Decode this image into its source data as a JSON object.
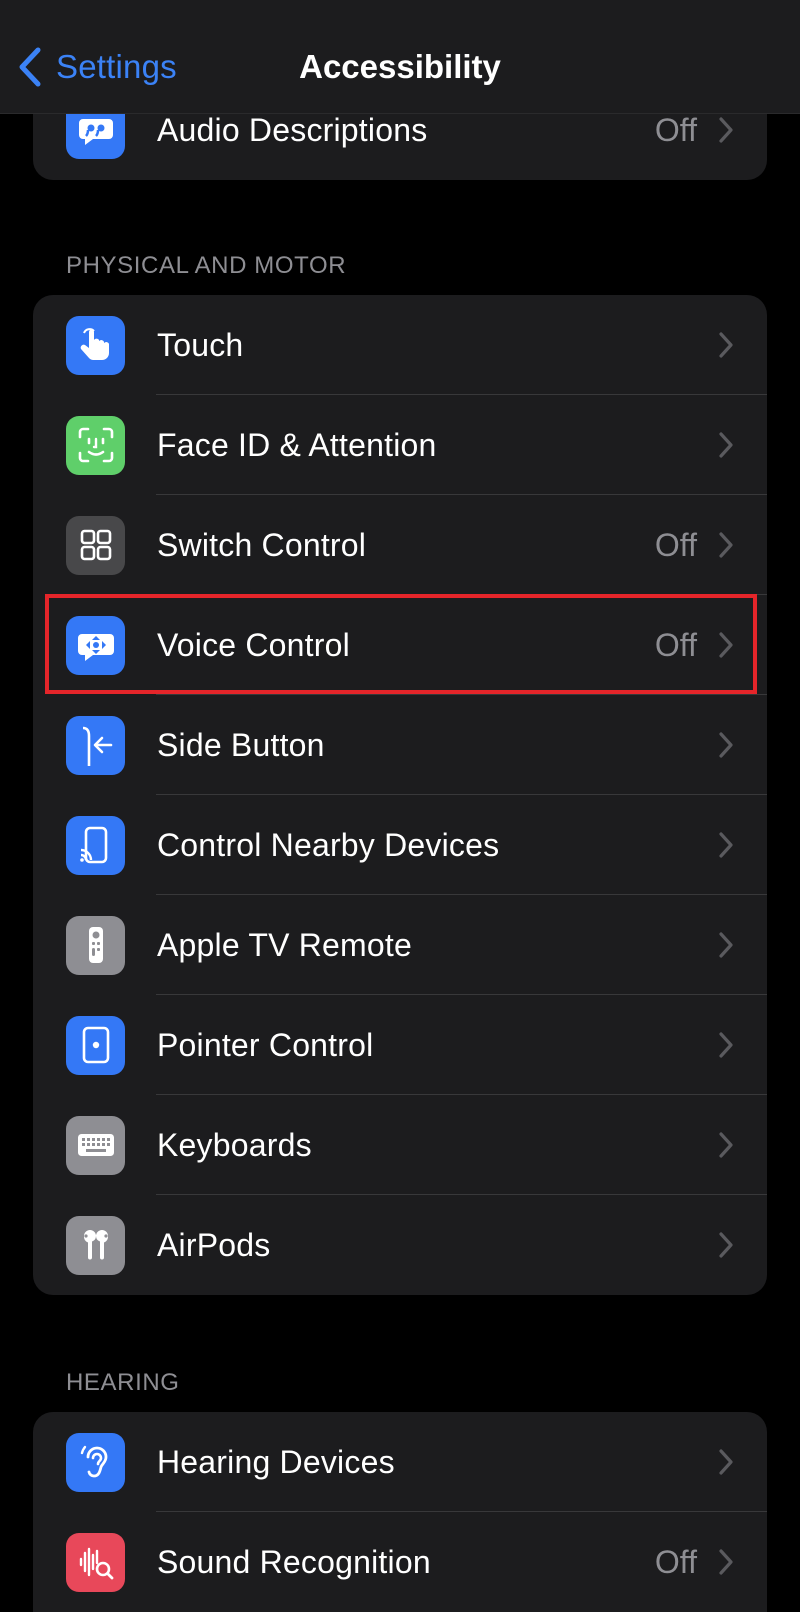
{
  "nav": {
    "back_label": "Settings",
    "title": "Accessibility"
  },
  "colors": {
    "accent": "#3b82f6",
    "highlight": "#e5252a",
    "background": "#000000",
    "group_bg": "#1c1c1e",
    "secondary_text": "#8e8e93"
  },
  "top_group": {
    "items": [
      {
        "label": "Audio Descriptions",
        "value": "Off",
        "icon": "audio-descriptions-icon",
        "icon_bg": "#3478f6"
      }
    ]
  },
  "physical_motor": {
    "header": "PHYSICAL AND MOTOR",
    "items": [
      {
        "label": "Touch",
        "value": "",
        "icon": "touch-icon",
        "icon_bg": "#3478f6"
      },
      {
        "label": "Face ID & Attention",
        "value": "",
        "icon": "face-id-icon",
        "icon_bg": "#5fcf6a"
      },
      {
        "label": "Switch Control",
        "value": "Off",
        "icon": "switch-control-icon",
        "icon_bg": "#48484a"
      },
      {
        "label": "Voice Control",
        "value": "Off",
        "icon": "voice-control-icon",
        "icon_bg": "#3478f6"
      },
      {
        "label": "Side Button",
        "value": "",
        "icon": "side-button-icon",
        "icon_bg": "#3478f6"
      },
      {
        "label": "Control Nearby Devices",
        "value": "",
        "icon": "control-nearby-devices-icon",
        "icon_bg": "#3478f6"
      },
      {
        "label": "Apple TV Remote",
        "value": "",
        "icon": "apple-tv-remote-icon",
        "icon_bg": "#8e8e93"
      },
      {
        "label": "Pointer Control",
        "value": "",
        "icon": "pointer-control-icon",
        "icon_bg": "#3478f6"
      },
      {
        "label": "Keyboards",
        "value": "",
        "icon": "keyboard-icon",
        "icon_bg": "#8e8e93"
      },
      {
        "label": "AirPods",
        "value": "",
        "icon": "airpods-icon",
        "icon_bg": "#8e8e93"
      }
    ]
  },
  "hearing": {
    "header": "HEARING",
    "items": [
      {
        "label": "Hearing Devices",
        "value": "",
        "icon": "ear-icon",
        "icon_bg": "#3478f6"
      },
      {
        "label": "Sound Recognition",
        "value": "Off",
        "icon": "sound-recognition-icon",
        "icon_bg": "#e8485a"
      }
    ]
  }
}
